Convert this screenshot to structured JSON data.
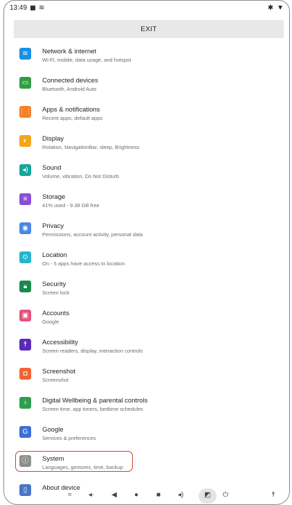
{
  "status_bar": {
    "time": "13:49"
  },
  "exit_label": "EXIT",
  "settings": [
    {
      "title": "Network & internet",
      "subtitle": "Wi-Fi, mobile, data usage, and hotspot",
      "icon": "wifi-icon",
      "color": "#1a8fe3",
      "glyph": "≋"
    },
    {
      "title": "Connected devices",
      "subtitle": "Bluetooth, Android Auto",
      "icon": "connected-devices-icon",
      "color": "#2e9e44",
      "glyph": "▭"
    },
    {
      "title": "Apps & notifications",
      "subtitle": "Recent apps, default apps",
      "icon": "apps-icon",
      "color": "#f4802a",
      "glyph": "⋮⋮"
    },
    {
      "title": "Display",
      "subtitle": "Rotation, NavigationBar, sleep, Brightness",
      "icon": "brightness-icon",
      "color": "#f3a61d",
      "glyph": "◐"
    },
    {
      "title": "Sound",
      "subtitle": "Volume, vibration, Do Not Disturb",
      "icon": "volume-icon",
      "color": "#14a69c",
      "glyph": "◂)"
    },
    {
      "title": "Storage",
      "subtitle": "41% used - 9.38 GB free",
      "icon": "storage-icon",
      "color": "#8c4fd6",
      "glyph": "≡"
    },
    {
      "title": "Privacy",
      "subtitle": "Permissions, account activity, personal data",
      "icon": "privacy-icon",
      "color": "#4a86e8",
      "glyph": "◉"
    },
    {
      "title": "Location",
      "subtitle": "On - 5 apps have access to location",
      "icon": "location-pin-icon",
      "color": "#22b5cf",
      "glyph": "⊙"
    },
    {
      "title": "Security",
      "subtitle": "Screen lock",
      "icon": "lock-icon",
      "color": "#168a4c",
      "glyph": "🔒︎"
    },
    {
      "title": "Accounts",
      "subtitle": "Google",
      "icon": "account-icon",
      "color": "#e8517b",
      "glyph": "▣"
    },
    {
      "title": "Accessibility",
      "subtitle": "Screen readers, display, interaction controls",
      "icon": "accessibility-icon",
      "color": "#5b2bb8",
      "glyph": "☨"
    },
    {
      "title": "Screenshot",
      "subtitle": "Screenshot",
      "icon": "camera-icon",
      "color": "#f06432",
      "glyph": "◘"
    },
    {
      "title": "Digital Wellbeing & parental controls",
      "subtitle": "Screen time, app timers, bedtime schedules",
      "icon": "wellbeing-icon",
      "color": "#2f9e4f",
      "glyph": "♁"
    },
    {
      "title": "Google",
      "subtitle": "Services & preferences",
      "icon": "google-icon",
      "color": "#3b6fd6",
      "glyph": "G"
    },
    {
      "title": "System",
      "subtitle": "Languages, gestures, time, backup",
      "icon": "info-icon",
      "color": "#8f8f8f",
      "glyph": "ⓘ"
    },
    {
      "title": "About device",
      "subtitle": "",
      "icon": "device-icon",
      "color": "#4a74c9",
      "glyph": "▯"
    }
  ]
}
